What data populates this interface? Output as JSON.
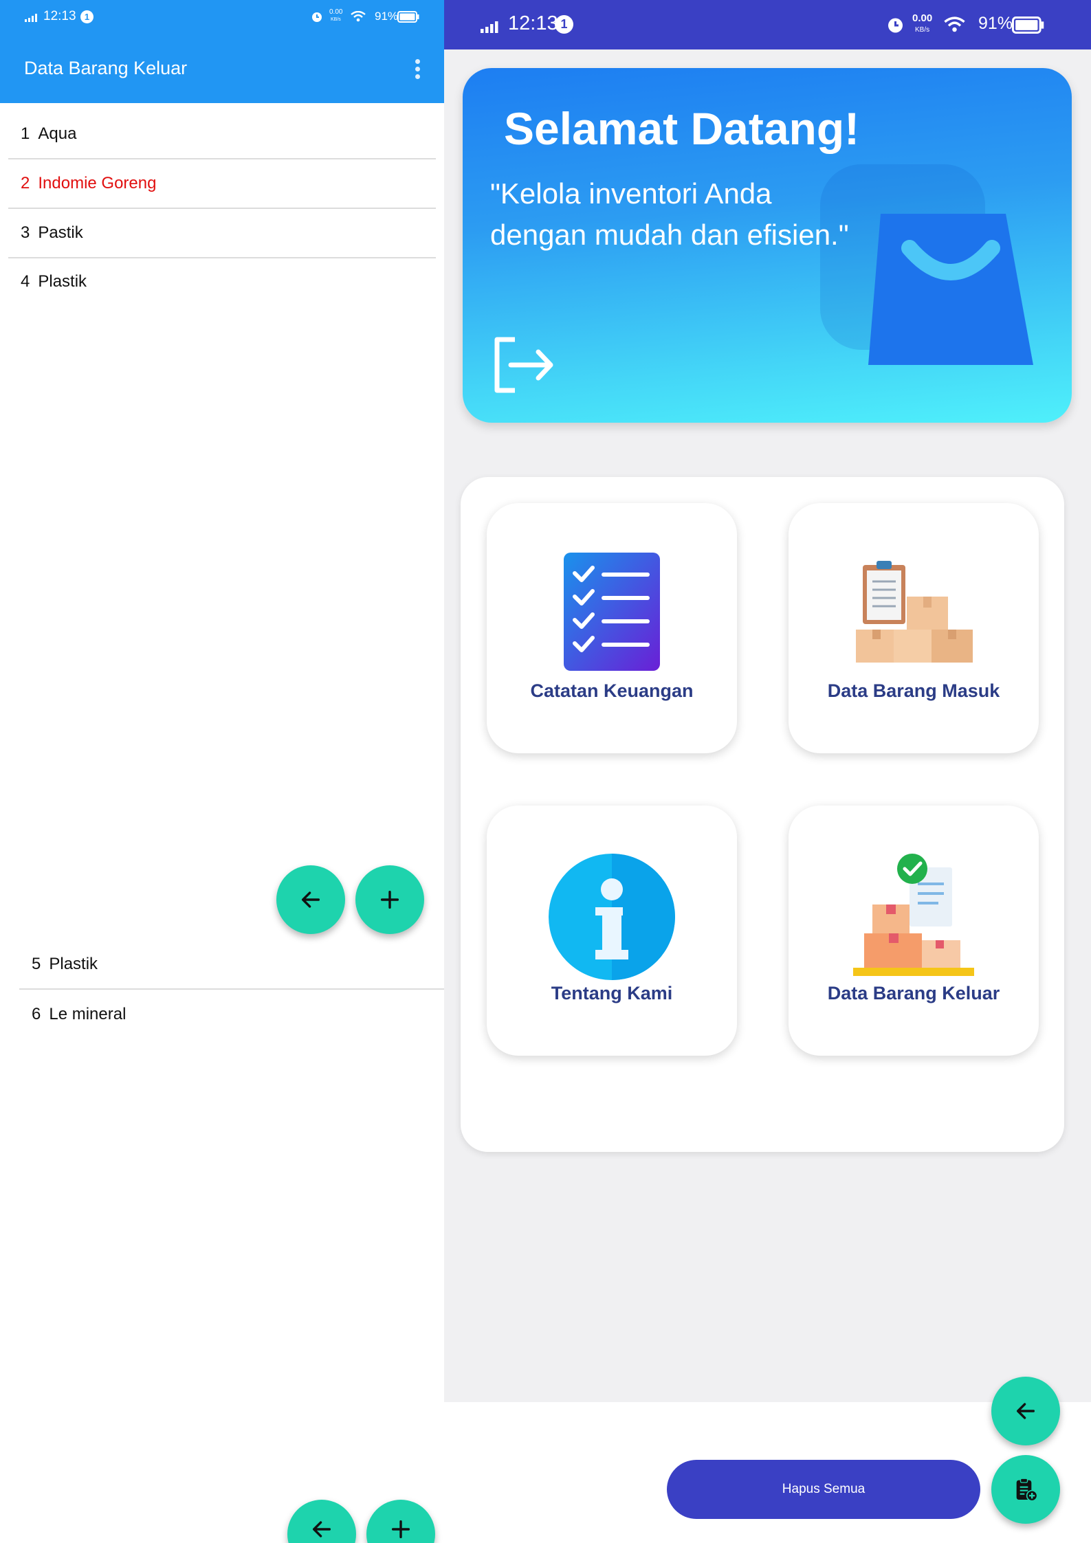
{
  "left_screen": {
    "status_bar": {
      "time": "12:13",
      "notification_count": "1",
      "net_speed_value": "0.00",
      "net_speed_unit": "KB/s",
      "battery": "91%"
    },
    "app_bar": {
      "title": "Data Barang Keluar",
      "menu_icon": "more-vert-icon"
    },
    "items_top": [
      {
        "number": "1",
        "name": "Aqua"
      },
      {
        "number": "2",
        "name": "Indomie Goreng"
      },
      {
        "number": "3",
        "name": "Pastik"
      },
      {
        "number": "4",
        "name": "Plastik"
      }
    ],
    "items_bottom": [
      {
        "number": "5",
        "name": "Plastik"
      },
      {
        "number": "6",
        "name": "Le mineral"
      }
    ],
    "colors": {
      "app_bar": "#2196f3",
      "fab": "#1ed3ad",
      "highlight_text": "#e10f0f"
    }
  },
  "right_screen": {
    "status_bar": {
      "time": "12:13",
      "notification_count": "1",
      "net_speed_value": "0.00",
      "net_speed_unit": "KB/s",
      "battery": "91%"
    },
    "banner": {
      "title": "Selamat Datang!",
      "subtitle": "\"Kelola inventori Anda dengan mudah dan efisien.\""
    },
    "menu": [
      {
        "label": "Catatan Keuangan",
        "icon": "checklist-icon"
      },
      {
        "label": "Data Barang Masuk",
        "icon": "clipboard-boxes-icon"
      },
      {
        "label": "Tentang Kami",
        "icon": "info-icon"
      },
      {
        "label": "Data Barang Keluar",
        "icon": "boxes-checkmark-icon"
      }
    ],
    "hapus_semua_label": "Hapus Semua",
    "colors": {
      "status_bar": "#3a40c4",
      "button": "#3a40c4",
      "fab": "#1ed3ad",
      "label": "#2b3c86"
    }
  }
}
